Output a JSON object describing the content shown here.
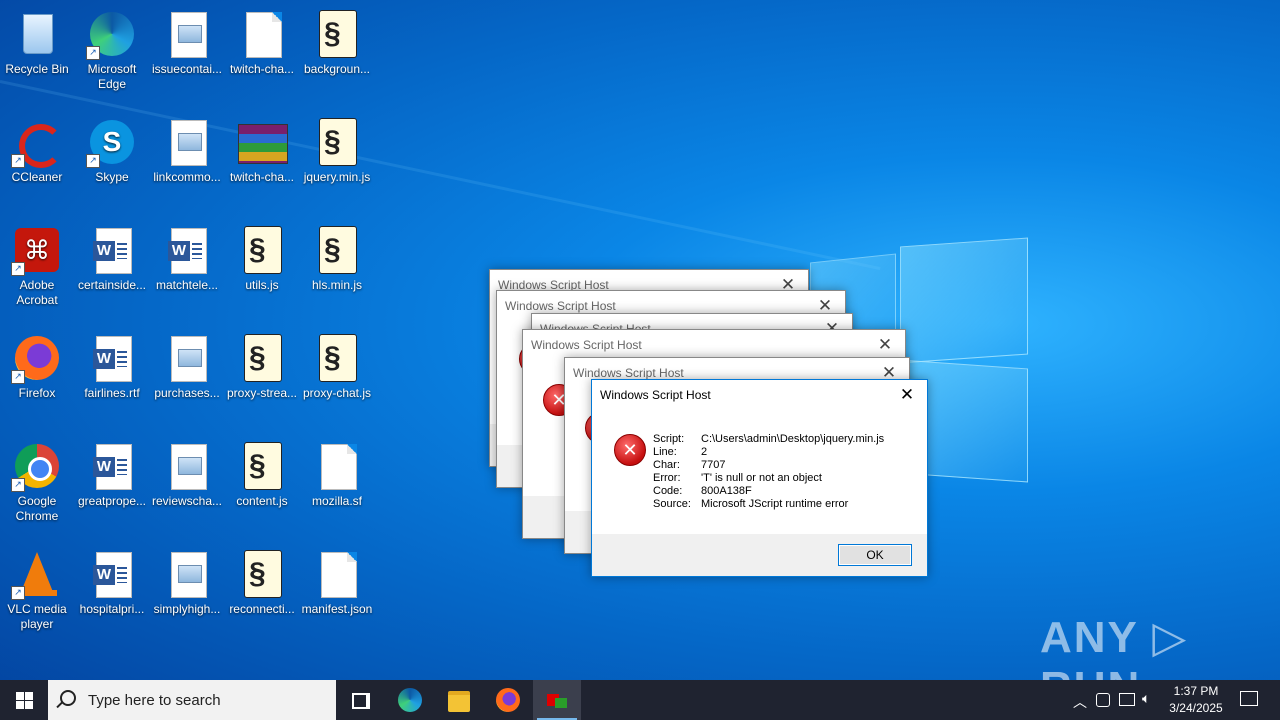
{
  "desktop": {
    "icons": [
      {
        "label": "Recycle Bin"
      },
      {
        "label": "Microsoft Edge"
      },
      {
        "label": "issuecontai..."
      },
      {
        "label": "twitch-cha..."
      },
      {
        "label": "backgroun..."
      },
      {
        "label": "CCleaner"
      },
      {
        "label": "Skype"
      },
      {
        "label": "linkcommo..."
      },
      {
        "label": "twitch-cha..."
      },
      {
        "label": "jquery.min.js"
      },
      {
        "label": "Adobe Acrobat"
      },
      {
        "label": "certainside..."
      },
      {
        "label": "matchtele..."
      },
      {
        "label": "utils.js"
      },
      {
        "label": "hls.min.js"
      },
      {
        "label": "Firefox"
      },
      {
        "label": "fairlines.rtf"
      },
      {
        "label": "purchases..."
      },
      {
        "label": "proxy-strea..."
      },
      {
        "label": "proxy-chat.js"
      },
      {
        "label": "Google Chrome"
      },
      {
        "label": "greatprope..."
      },
      {
        "label": "reviewscha..."
      },
      {
        "label": "content.js"
      },
      {
        "label": "mozilla.sf"
      },
      {
        "label": "VLC media player"
      },
      {
        "label": "hospitalpri..."
      },
      {
        "label": "simplyhigh..."
      },
      {
        "label": "reconnecti..."
      },
      {
        "label": "manifest.json"
      }
    ]
  },
  "dialogs": {
    "title": "Windows Script Host",
    "close_glyph": "✕",
    "error": {
      "script_label": "Script:",
      "script": "C:\\Users\\admin\\Desktop\\jquery.min.js",
      "line_label": "Line:",
      "line": "2",
      "char_label": "Char:",
      "char": "7707",
      "error_label": "Error:",
      "error": "'T' is null or not an object",
      "code_label": "Code:",
      "code": "800A138F",
      "source_label": "Source:",
      "source": "Microsoft JScript runtime error"
    },
    "ok_label": "OK"
  },
  "watermark": "ANY ▷ RUN",
  "taskbar": {
    "search_placeholder": "Type here to search",
    "time": "1:37 PM",
    "date": "3/24/2025"
  },
  "colors": {
    "taskbar": "#1f2330",
    "accent": "#0078d7",
    "error": "#c50f0f"
  }
}
